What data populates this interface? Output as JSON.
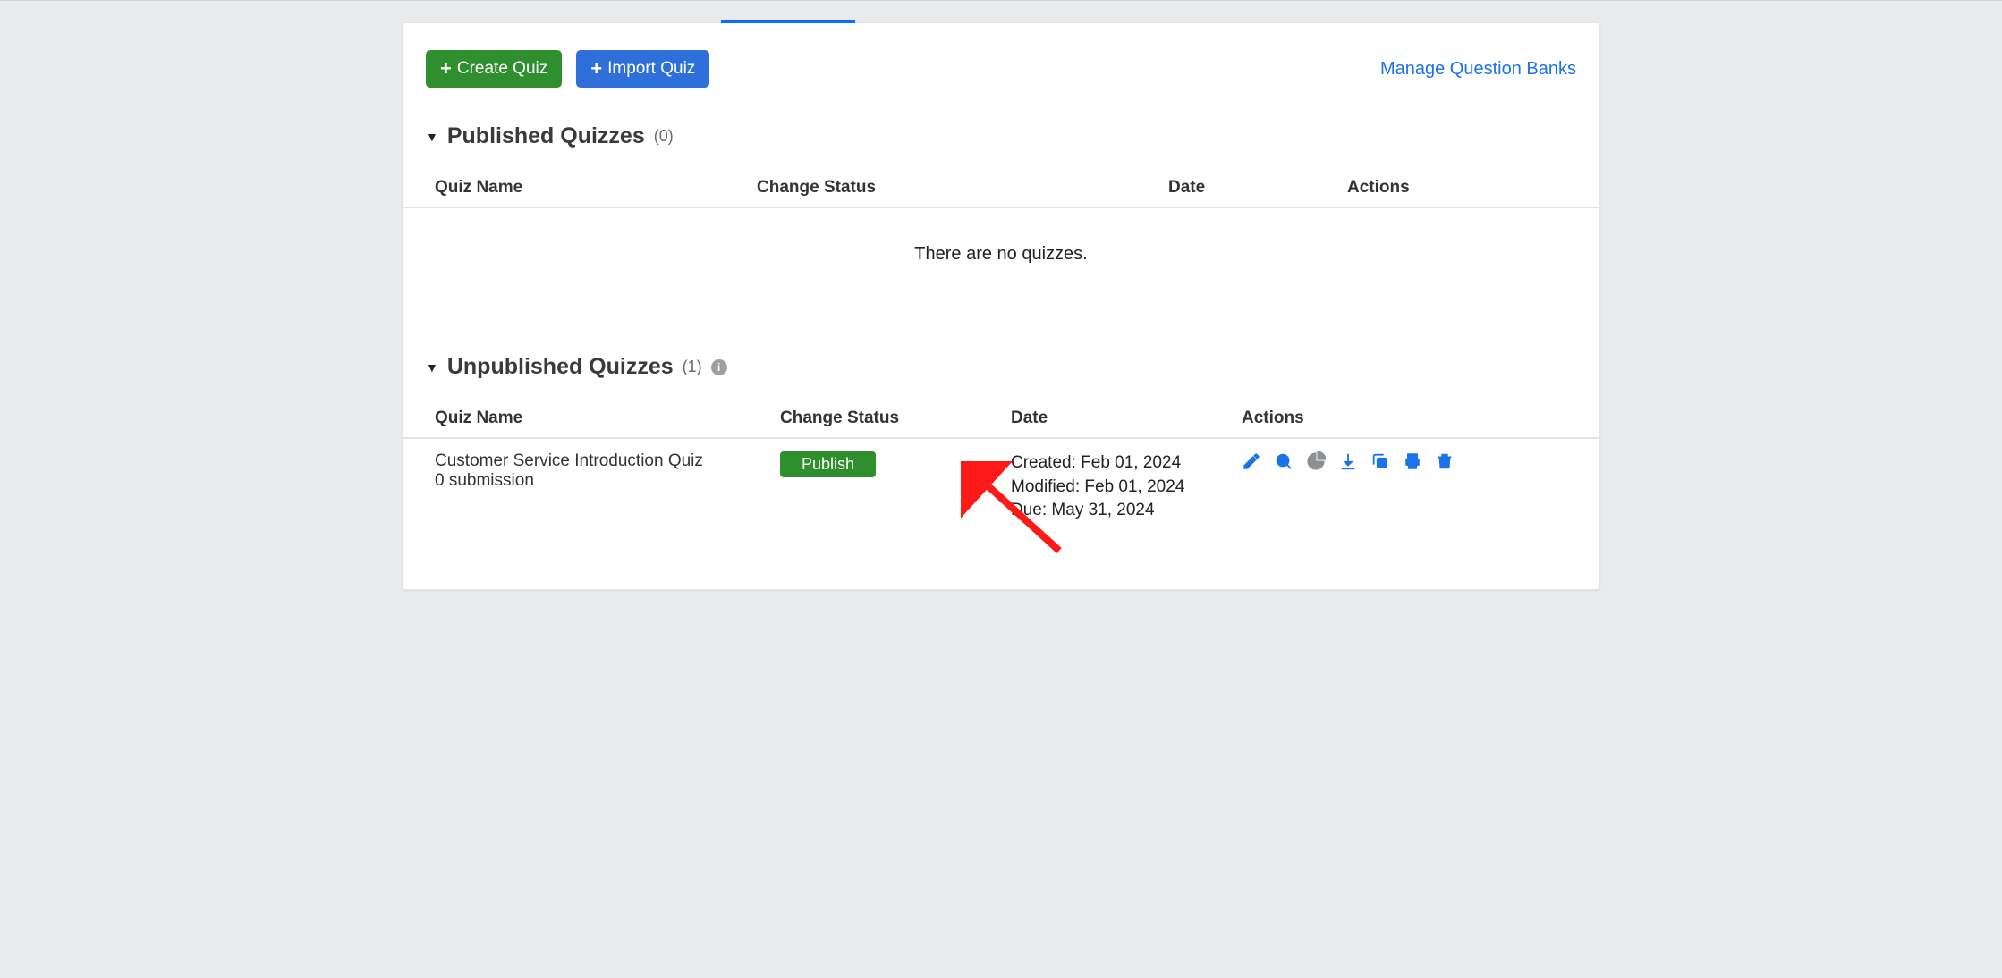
{
  "toolbar": {
    "create_label": "Create Quiz",
    "import_label": "Import Quiz",
    "manage_link": "Manage Question Banks"
  },
  "sections": {
    "published": {
      "title": "Published Quizzes",
      "count": "(0)",
      "columns": {
        "name": "Quiz Name",
        "status": "Change Status",
        "date": "Date",
        "actions": "Actions"
      },
      "empty": "There are no quizzes."
    },
    "unpublished": {
      "title": "Unpublished Quizzes",
      "count": "(1)",
      "columns": {
        "name": "Quiz Name",
        "status": "Change Status",
        "date": "Date",
        "actions": "Actions"
      },
      "rows": [
        {
          "name": "Customer Service Introduction Quiz",
          "submissions": "0 submission",
          "publish_label": "Publish",
          "created_label": "Created:",
          "created_date": "Feb 01, 2024",
          "modified_label": "Modified:",
          "modified_date": "Feb 01, 2024",
          "due_label": "Due:",
          "due_date": "May 31, 2024"
        }
      ]
    }
  }
}
